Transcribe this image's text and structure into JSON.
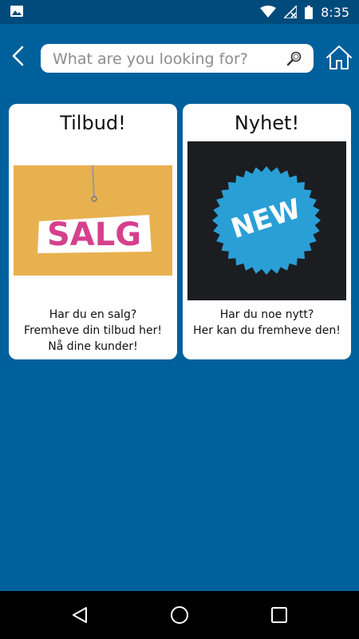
{
  "status_bar": {
    "time": "8:35",
    "icons": [
      "image-icon",
      "wifi-icon",
      "signal-icon",
      "battery-icon"
    ]
  },
  "header": {
    "search_placeholder": "What are you looking for?",
    "search_value": ""
  },
  "cards": [
    {
      "title": "Tilbud!",
      "image_text": "SALG",
      "description": [
        "Har du en salg?",
        "Fremheve din tilbud her!",
        "Nå dine kunder!"
      ]
    },
    {
      "title": "Nyhet!",
      "image_text": "NEW",
      "description": [
        "Har du noe nytt?",
        "Her kan du fremheve den!"
      ]
    }
  ],
  "colors": {
    "background": "#00609c",
    "status_bar": "#004b7c",
    "salg_bg": "#e8b14f",
    "salg_text": "#d6408d",
    "new_bg": "#1b1d21",
    "new_badge": "#2a9fd6"
  }
}
